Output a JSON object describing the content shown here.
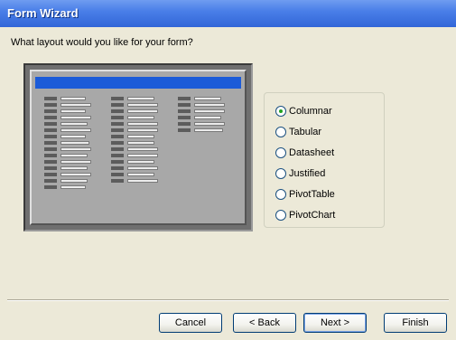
{
  "window": {
    "title": "Form Wizard"
  },
  "prompt": "What layout would you like for your form?",
  "layout_options": [
    {
      "label": "Columnar",
      "selected": true
    },
    {
      "label": "Tabular",
      "selected": false
    },
    {
      "label": "Datasheet",
      "selected": false
    },
    {
      "label": "Justified",
      "selected": false
    },
    {
      "label": "PivotTable",
      "selected": false
    },
    {
      "label": "PivotChart",
      "selected": false
    }
  ],
  "buttons": {
    "cancel": "Cancel",
    "back": "< Back",
    "next": "Next >",
    "finish": "Finish"
  },
  "colors": {
    "titlebar": "#3266d8",
    "preview_header": "#1b5bd8",
    "dialog_bg": "#ece9d8"
  }
}
